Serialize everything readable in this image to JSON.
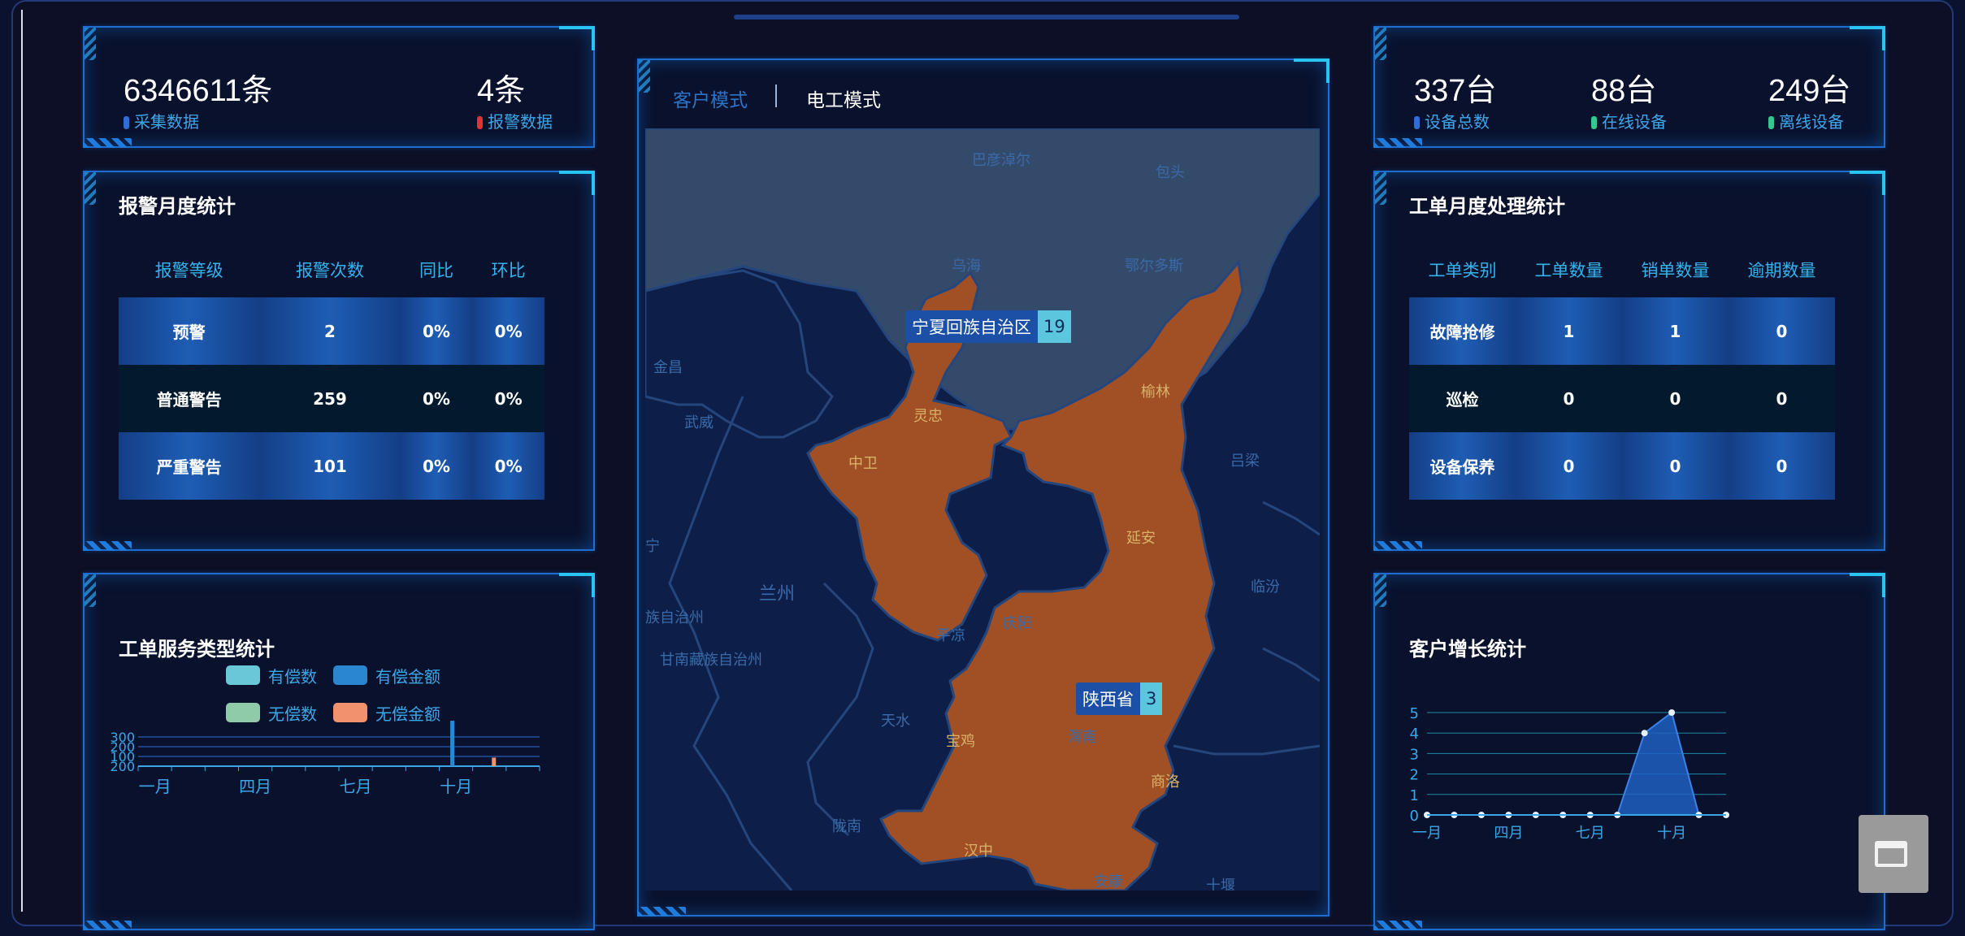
{
  "stats_left": [
    {
      "value": "6346611条",
      "label": "采集数据",
      "color": "#2e6fd6"
    },
    {
      "value": "4条",
      "label": "报警数据",
      "color": "#e23232"
    }
  ],
  "stats_right": [
    {
      "value": "337台",
      "label": "设备总数",
      "color": "#2e6fd6"
    },
    {
      "value": "88台",
      "label": "在线设备",
      "color": "#36c78f"
    },
    {
      "value": "249台",
      "label": "离线设备",
      "color": "#36c78f"
    }
  ],
  "alarm_panel": {
    "title": "报警月度统计",
    "headers": [
      "报警等级",
      "报警次数",
      "同比",
      "环比"
    ],
    "rows": [
      [
        "预警",
        "2",
        "0%",
        "0%"
      ],
      [
        "普通警告",
        "259",
        "0%",
        "0%"
      ],
      [
        "严重警告",
        "101",
        "0%",
        "0%"
      ]
    ]
  },
  "work_panel": {
    "title": "工单月度处理统计",
    "headers": [
      "工单类别",
      "工单数量",
      "销单数量",
      "逾期数量"
    ],
    "rows": [
      [
        "故障抢修",
        "1",
        "1",
        "0"
      ],
      [
        "巡检",
        "0",
        "0",
        "0"
      ],
      [
        "设备保养",
        "0",
        "0",
        "0"
      ]
    ]
  },
  "map_panel": {
    "tabs": [
      {
        "label": "客户模式",
        "active": false
      },
      {
        "label": "电工模式",
        "active": true
      }
    ],
    "regions": [
      {
        "name": "宁夏回族自治区",
        "count": "19"
      },
      {
        "name": "陕西省",
        "count": "3"
      }
    ],
    "cities": [
      "巴彦淖尔",
      "包头",
      "乌海",
      "鄂尔多斯",
      "金昌",
      "武威",
      "灵忠",
      "榆林",
      "吕梁",
      "中卫",
      "宁",
      "延安",
      "兰州",
      "临汾",
      "庆阳",
      "族自治州",
      "平凉",
      "甘南藏族自治州",
      "天水",
      "宝鸡",
      "渭南",
      "商洛",
      "陇南",
      "汉中",
      "安康",
      "十堰"
    ]
  },
  "service_chart": {
    "title": "工单服务类型统计",
    "legend": [
      {
        "name": "有偿数",
        "color": "#6ac7d8"
      },
      {
        "name": "有偿金额",
        "color": "#2b86d1"
      },
      {
        "name": "无偿数",
        "color": "#8fcba8"
      },
      {
        "name": "无偿金额",
        "color": "#f2916e"
      }
    ],
    "yticks": [
      "300",
      "200",
      "100",
      "200"
    ],
    "xticks": [
      "一月",
      "四月",
      "七月",
      "十月"
    ]
  },
  "chart_data": [
    {
      "type": "bar",
      "title": "工单服务类型统计",
      "categories": [
        "一月",
        "二月",
        "三月",
        "四月",
        "五月",
        "六月",
        "七月",
        "八月",
        "九月",
        "十月",
        "十一月",
        "十二月"
      ],
      "series": [
        {
          "name": "有偿数",
          "values": [
            0,
            0,
            0,
            0,
            0,
            0,
            0,
            0,
            0,
            0,
            0,
            0
          ]
        },
        {
          "name": "有偿金额",
          "values": [
            0,
            0,
            0,
            0,
            0,
            0,
            0,
            0,
            0,
            1800,
            0,
            0
          ]
        },
        {
          "name": "无偿数",
          "values": [
            0,
            0,
            0,
            0,
            0,
            0,
            0,
            0,
            0,
            0,
            0,
            0
          ]
        },
        {
          "name": "无偿金额",
          "values": [
            0,
            0,
            0,
            0,
            0,
            0,
            0,
            0,
            0,
            0,
            250,
            0
          ]
        }
      ]
    },
    {
      "type": "area",
      "title": "客户增长统计",
      "x": [
        "一月",
        "二月",
        "三月",
        "四月",
        "五月",
        "六月",
        "七月",
        "八月",
        "九月",
        "十月",
        "十一月",
        "十二月"
      ],
      "series": [
        {
          "values": [
            0,
            0,
            0,
            0,
            0,
            0,
            0,
            0,
            4,
            5,
            0,
            0
          ]
        }
      ],
      "ylim": [
        0,
        5
      ],
      "yticks": [
        "5",
        "4",
        "3",
        "2",
        "1",
        "0"
      ],
      "xtick_labels": [
        "一月",
        "四月",
        "七月",
        "十月"
      ]
    }
  ],
  "growth_chart": {
    "title": "客户增长统计"
  }
}
